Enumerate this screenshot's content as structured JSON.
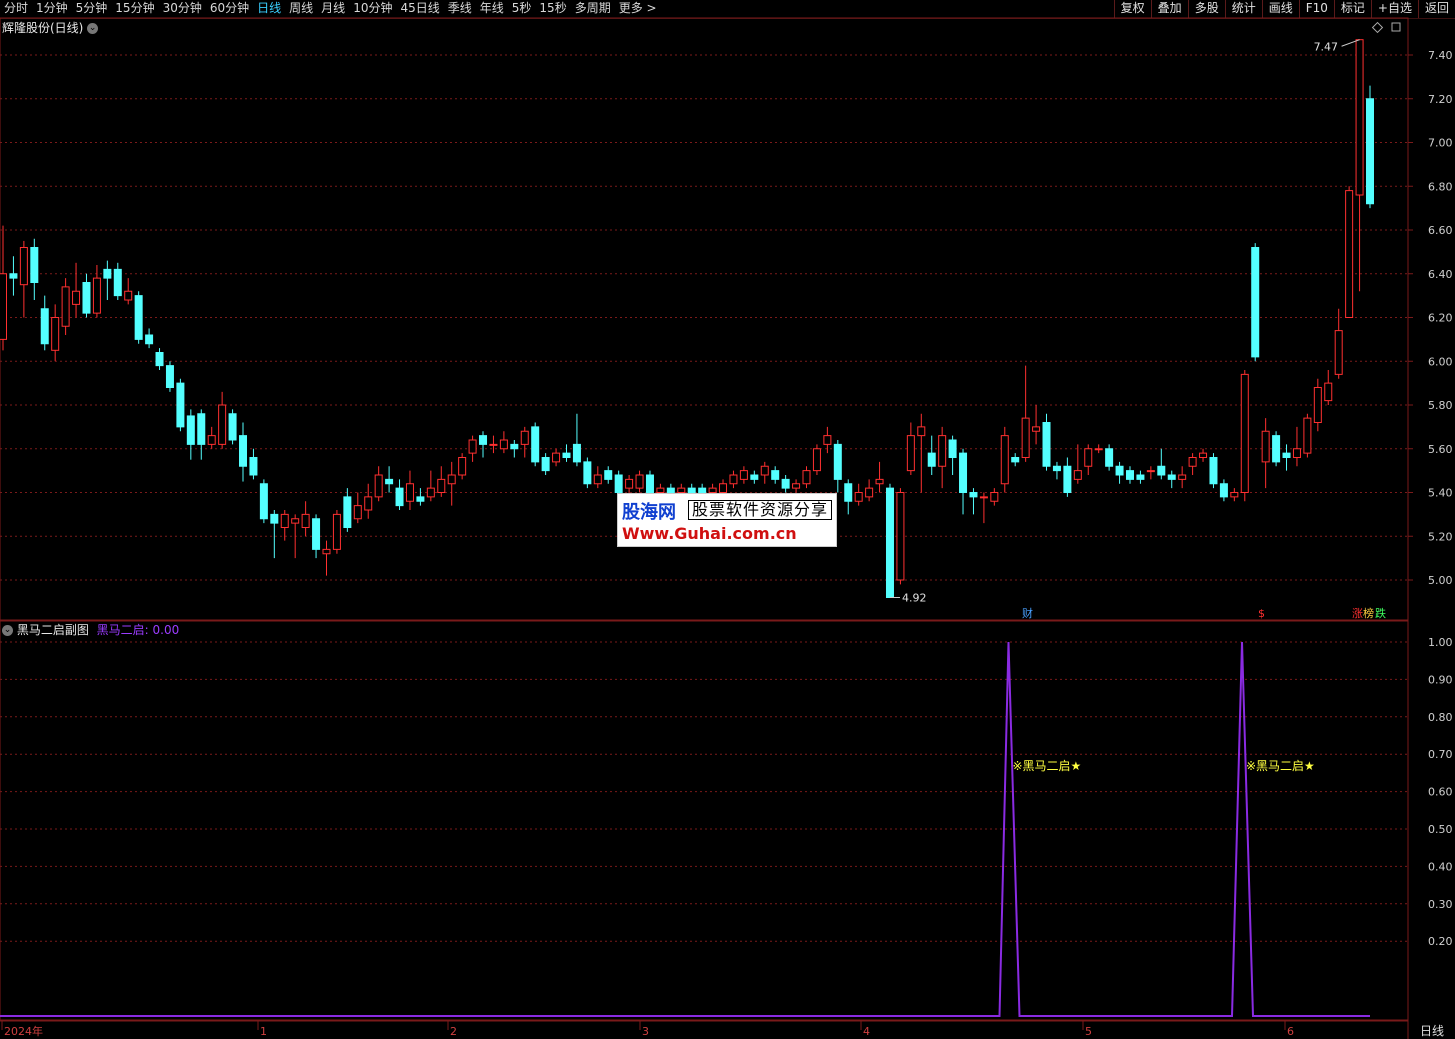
{
  "toolbar": {
    "periods": [
      "分时",
      "1分钟",
      "5分钟",
      "15分钟",
      "30分钟",
      "60分钟",
      "日线",
      "周线",
      "月线",
      "10分钟",
      "45日线",
      "季线",
      "年线",
      "5秒",
      "15秒",
      "多周期",
      "更多 >"
    ],
    "active_period": "日线",
    "right_buttons": [
      "复权",
      "叠加",
      "多股",
      "统计",
      "画线",
      "F10",
      "标记",
      "+自选",
      "返回"
    ]
  },
  "main_panel": {
    "title": "辉隆股份(日线)",
    "high_label": "7.47",
    "low_label": "4.92",
    "markers": {
      "cai": "财",
      "dollar": "$",
      "zhang": "涨",
      "bang": "榜",
      "die": "跌"
    }
  },
  "sub_panel": {
    "title": "黑马二启副图",
    "indicator": "黑马二启: 0.00",
    "signal_label": "※黑马二启★"
  },
  "x_axis": {
    "labels": [
      "2024年",
      "1",
      "2",
      "3",
      "4",
      "5",
      "6"
    ],
    "period_button": "日线"
  },
  "logo": {
    "name": "股海网",
    "slogan": "股票软件资源分享",
    "url": "Www.Guhai.com.cn"
  },
  "colors": {
    "up": "#ff3030",
    "down": "#54ffff",
    "grid": "#7a1a1a",
    "indicator": "#8a2be2"
  },
  "chart_data": {
    "type": "candlestick",
    "ylim_main": [
      4.92,
      7.47
    ],
    "y_ticks_main": [
      5.0,
      5.2,
      5.4,
      5.6,
      5.8,
      6.0,
      6.2,
      6.4,
      6.6,
      6.8,
      7.0,
      7.2,
      7.4
    ],
    "y_ticks_sub": [
      0.2,
      0.3,
      0.4,
      0.5,
      0.6,
      0.7,
      0.8,
      0.9,
      1.0
    ],
    "candles": [
      [
        6.1,
        6.4,
        6.62,
        6.05
      ],
      [
        6.4,
        6.38,
        6.48,
        6.3
      ],
      [
        6.35,
        6.52,
        6.55,
        6.2
      ],
      [
        6.52,
        6.36,
        6.56,
        6.28
      ],
      [
        6.24,
        6.08,
        6.3,
        6.05
      ],
      [
        6.05,
        6.2,
        6.26,
        6.0
      ],
      [
        6.16,
        6.34,
        6.38,
        6.12
      ],
      [
        6.26,
        6.32,
        6.45,
        6.2
      ],
      [
        6.36,
        6.22,
        6.4,
        6.2
      ],
      [
        6.22,
        6.38,
        6.44,
        6.2
      ],
      [
        6.42,
        6.38,
        6.46,
        6.28
      ],
      [
        6.42,
        6.3,
        6.45,
        6.28
      ],
      [
        6.28,
        6.32,
        6.38,
        6.26
      ],
      [
        6.3,
        6.1,
        6.32,
        6.08
      ],
      [
        6.12,
        6.08,
        6.15,
        6.06
      ],
      [
        6.04,
        5.98,
        6.06,
        5.96
      ],
      [
        5.98,
        5.88,
        6.0,
        5.86
      ],
      [
        5.9,
        5.7,
        5.92,
        5.68
      ],
      [
        5.75,
        5.62,
        5.78,
        5.55
      ],
      [
        5.76,
        5.62,
        5.78,
        5.55
      ],
      [
        5.62,
        5.66,
        5.7,
        5.6
      ],
      [
        5.62,
        5.8,
        5.86,
        5.6
      ],
      [
        5.76,
        5.64,
        5.78,
        5.62
      ],
      [
        5.66,
        5.52,
        5.72,
        5.45
      ],
      [
        5.56,
        5.48,
        5.6,
        5.46
      ],
      [
        5.44,
        5.28,
        5.46,
        5.26
      ],
      [
        5.3,
        5.26,
        5.32,
        5.1
      ],
      [
        5.24,
        5.3,
        5.32,
        5.18
      ],
      [
        5.26,
        5.28,
        5.3,
        5.1
      ],
      [
        5.24,
        5.3,
        5.36,
        5.2
      ],
      [
        5.28,
        5.14,
        5.3,
        5.1
      ],
      [
        5.12,
        5.14,
        5.18,
        5.02
      ],
      [
        5.14,
        5.3,
        5.32,
        5.12
      ],
      [
        5.38,
        5.24,
        5.42,
        5.22
      ],
      [
        5.28,
        5.34,
        5.4,
        5.26
      ],
      [
        5.32,
        5.38,
        5.44,
        5.28
      ],
      [
        5.38,
        5.48,
        5.52,
        5.36
      ],
      [
        5.46,
        5.44,
        5.52,
        5.4
      ],
      [
        5.42,
        5.34,
        5.46,
        5.32
      ],
      [
        5.36,
        5.44,
        5.5,
        5.32
      ],
      [
        5.38,
        5.36,
        5.42,
        5.34
      ],
      [
        5.38,
        5.42,
        5.5,
        5.36
      ],
      [
        5.4,
        5.46,
        5.52,
        5.38
      ],
      [
        5.44,
        5.48,
        5.54,
        5.34
      ],
      [
        5.48,
        5.56,
        5.58,
        5.46
      ],
      [
        5.58,
        5.64,
        5.66,
        5.54
      ],
      [
        5.66,
        5.62,
        5.68,
        5.56
      ],
      [
        5.62,
        5.62,
        5.66,
        5.58
      ],
      [
        5.6,
        5.64,
        5.68,
        5.58
      ],
      [
        5.62,
        5.6,
        5.64,
        5.56
      ],
      [
        5.62,
        5.68,
        5.7,
        5.56
      ],
      [
        5.7,
        5.54,
        5.72,
        5.52
      ],
      [
        5.56,
        5.5,
        5.58,
        5.48
      ],
      [
        5.54,
        5.58,
        5.6,
        5.52
      ],
      [
        5.58,
        5.56,
        5.62,
        5.54
      ],
      [
        5.62,
        5.54,
        5.76,
        5.52
      ],
      [
        5.54,
        5.44,
        5.56,
        5.42
      ],
      [
        5.44,
        5.48,
        5.52,
        5.42
      ],
      [
        5.5,
        5.46,
        5.52,
        5.44
      ],
      [
        5.48,
        5.4,
        5.5,
        5.38
      ],
      [
        5.42,
        5.46,
        5.48,
        5.38
      ],
      [
        5.42,
        5.48,
        5.5,
        5.4
      ],
      [
        5.48,
        5.4,
        5.5,
        5.38
      ],
      [
        5.4,
        5.42,
        5.44,
        5.38
      ],
      [
        5.42,
        5.4,
        5.44,
        5.38
      ],
      [
        5.4,
        5.42,
        5.44,
        5.38
      ],
      [
        5.42,
        5.4,
        5.44,
        5.38
      ],
      [
        5.42,
        5.4,
        5.44,
        5.38
      ],
      [
        5.4,
        5.42,
        5.44,
        5.38
      ],
      [
        5.4,
        5.44,
        5.46,
        5.38
      ],
      [
        5.44,
        5.48,
        5.5,
        5.42
      ],
      [
        5.46,
        5.5,
        5.52,
        5.44
      ],
      [
        5.48,
        5.46,
        5.5,
        5.44
      ],
      [
        5.48,
        5.52,
        5.54,
        5.44
      ],
      [
        5.5,
        5.46,
        5.52,
        5.44
      ],
      [
        5.46,
        5.42,
        5.48,
        5.4
      ],
      [
        5.42,
        5.44,
        5.46,
        5.4
      ],
      [
        5.44,
        5.5,
        5.52,
        5.42
      ],
      [
        5.5,
        5.6,
        5.62,
        5.48
      ],
      [
        5.62,
        5.66,
        5.7,
        5.58
      ],
      [
        5.62,
        5.46,
        5.64,
        5.4
      ],
      [
        5.44,
        5.36,
        5.46,
        5.3
      ],
      [
        5.36,
        5.4,
        5.44,
        5.34
      ],
      [
        5.38,
        5.42,
        5.46,
        5.36
      ],
      [
        5.44,
        5.46,
        5.54,
        5.4
      ],
      [
        5.42,
        4.92,
        5.44,
        4.92
      ],
      [
        5.0,
        5.4,
        5.42,
        4.98
      ],
      [
        5.5,
        5.66,
        5.72,
        5.48
      ],
      [
        5.66,
        5.7,
        5.76,
        5.4
      ],
      [
        5.58,
        5.52,
        5.66,
        5.48
      ],
      [
        5.52,
        5.66,
        5.7,
        5.42
      ],
      [
        5.64,
        5.56,
        5.66,
        5.48
      ],
      [
        5.58,
        5.4,
        5.6,
        5.3
      ],
      [
        5.4,
        5.38,
        5.42,
        5.3
      ],
      [
        5.38,
        5.38,
        5.4,
        5.26
      ],
      [
        5.36,
        5.4,
        5.42,
        5.34
      ],
      [
        5.44,
        5.66,
        5.7,
        5.4
      ],
      [
        5.56,
        5.54,
        5.58,
        5.52
      ],
      [
        5.56,
        5.74,
        5.98,
        5.54
      ],
      [
        5.68,
        5.7,
        5.8,
        5.62
      ],
      [
        5.72,
        5.52,
        5.76,
        5.5
      ],
      [
        5.52,
        5.5,
        5.54,
        5.46
      ],
      [
        5.52,
        5.4,
        5.56,
        5.38
      ],
      [
        5.46,
        5.5,
        5.62,
        5.44
      ],
      [
        5.52,
        5.6,
        5.62,
        5.48
      ],
      [
        5.6,
        5.6,
        5.62,
        5.58
      ],
      [
        5.6,
        5.52,
        5.62,
        5.5
      ],
      [
        5.52,
        5.48,
        5.54,
        5.44
      ],
      [
        5.5,
        5.46,
        5.52,
        5.44
      ],
      [
        5.48,
        5.46,
        5.5,
        5.44
      ],
      [
        5.5,
        5.5,
        5.52,
        5.46
      ],
      [
        5.52,
        5.48,
        5.6,
        5.46
      ],
      [
        5.48,
        5.46,
        5.5,
        5.42
      ],
      [
        5.46,
        5.48,
        5.52,
        5.42
      ],
      [
        5.52,
        5.56,
        5.58,
        5.48
      ],
      [
        5.56,
        5.58,
        5.6,
        5.54
      ],
      [
        5.56,
        5.44,
        5.58,
        5.42
      ],
      [
        5.44,
        5.38,
        5.46,
        5.36
      ],
      [
        5.38,
        5.4,
        5.42,
        5.36
      ],
      [
        5.4,
        5.94,
        5.96,
        5.36
      ],
      [
        6.52,
        6.02,
        6.54,
        6.0
      ],
      [
        5.54,
        5.68,
        5.74,
        5.42
      ],
      [
        5.66,
        5.54,
        5.68,
        5.52
      ],
      [
        5.58,
        5.56,
        5.62,
        5.5
      ],
      [
        5.56,
        5.6,
        5.7,
        5.52
      ],
      [
        5.58,
        5.74,
        5.76,
        5.56
      ],
      [
        5.72,
        5.88,
        5.92,
        5.68
      ],
      [
        5.82,
        5.9,
        5.96,
        5.8
      ],
      [
        5.94,
        6.14,
        6.24,
        5.92
      ],
      [
        6.2,
        6.78,
        6.8,
        6.2
      ],
      [
        6.76,
        7.47,
        7.47,
        6.32
      ],
      [
        7.2,
        6.72,
        7.26,
        6.7
      ]
    ],
    "indicator_values_note": "0 everywhere except two spikes to 1.00",
    "indicator_spikes": [
      1.0,
      1.0
    ]
  }
}
